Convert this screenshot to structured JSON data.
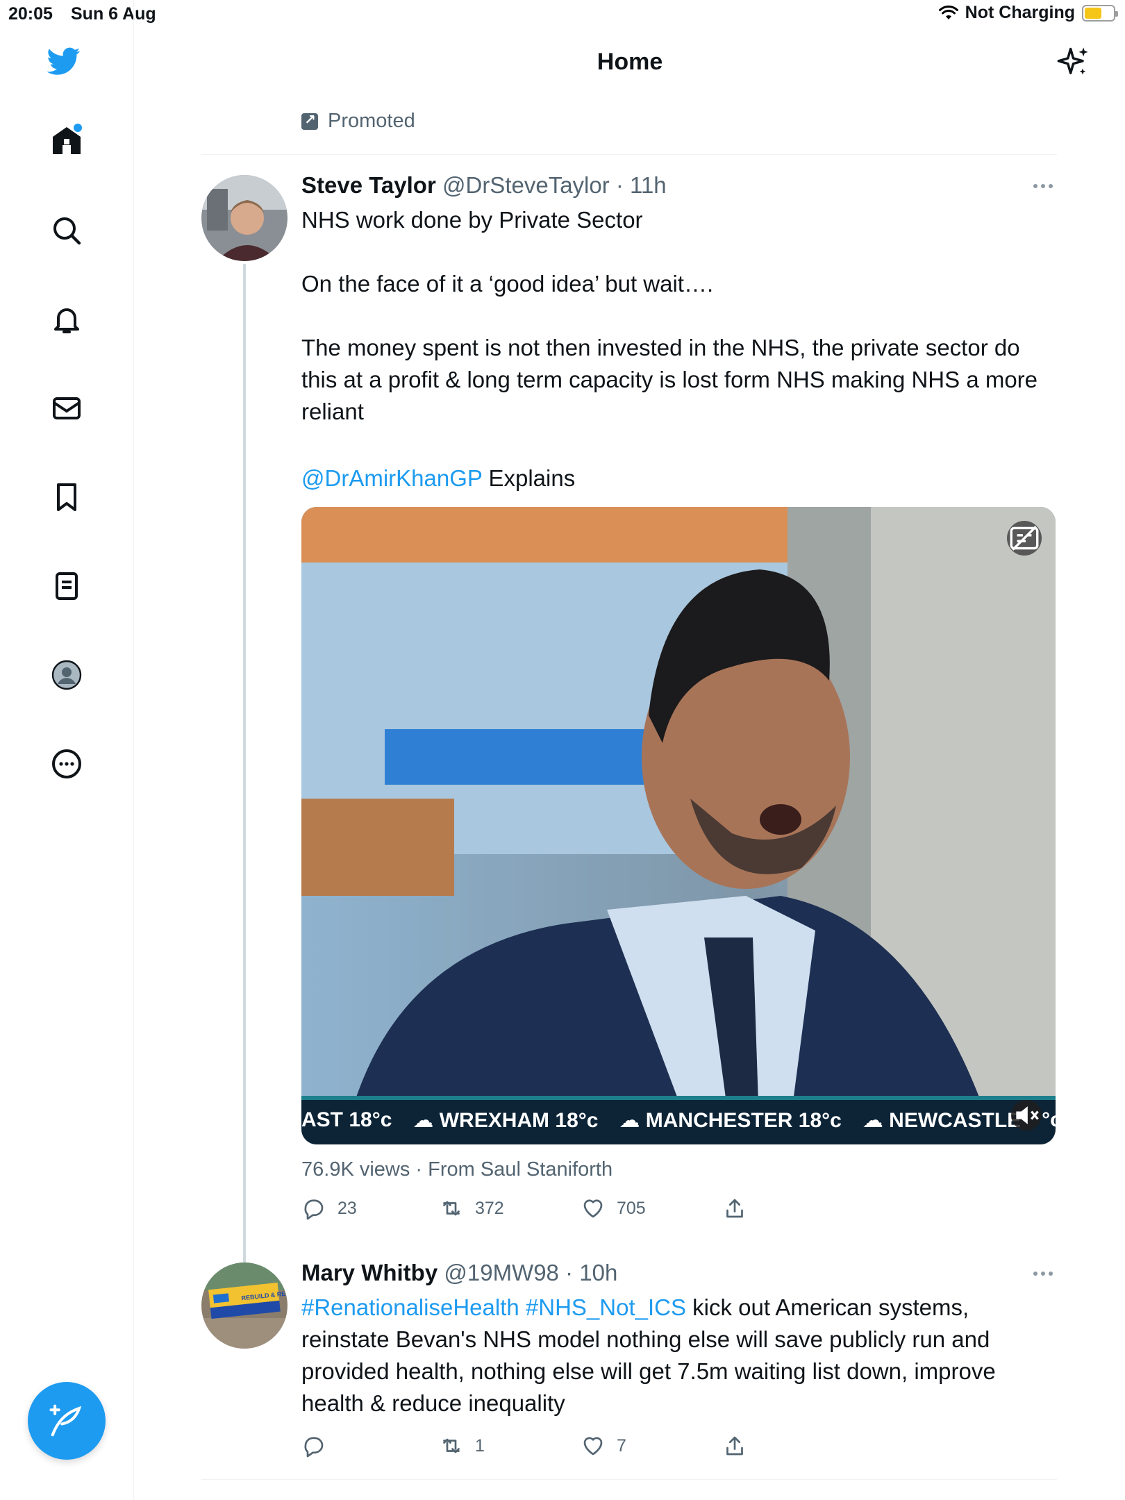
{
  "status_bar": {
    "time": "20:05",
    "date": "Sun 6 Aug",
    "charging": "Not Charging"
  },
  "header": {
    "title": "Home"
  },
  "promoted": {
    "label": "Promoted"
  },
  "tweets": [
    {
      "name": "Steve Taylor",
      "handle": "@DrSteveTaylor",
      "time": "· 11h",
      "line1": "NHS work done by Private Sector",
      "line2": "On the face of it a ‘good idea’ but wait….",
      "line3": "The money spent is not then invested in the NHS, the private sector do this at a profit & long term capacity is lost form NHS making NHS a more reliant",
      "mention": "@DrAmirKhanGP",
      "mention_suffix": " Explains",
      "ticker": [
        "AST  18°c",
        "☁ WREXHAM  18°c",
        "☁ MANCHESTER  18°c",
        "☁ NEWCASTLE",
        "°c"
      ],
      "views": "76.9K views · From Saul Staniforth",
      "replies": "23",
      "retweets": "372",
      "likes": "705"
    },
    {
      "name": "Mary Whitby",
      "handle": "@19MW98",
      "time": "· 10h",
      "hashtag1": "#RenationaliseHealth",
      "hashtag2": "#NHS_Not_ICS",
      "text": " kick out American systems, reinstate Bevan's NHS model nothing else will save publicly run and provided health, nothing else will get 7.5m waiting list down, improve health & reduce inequality",
      "avatar_text": "REBUILD & RESTORE THE NHS",
      "replies": "",
      "retweets": "1",
      "likes": "7"
    }
  ],
  "colors": {
    "accent": "#1d9bf0",
    "secondary_text": "#536471",
    "divider": "#eff3f4"
  },
  "icons": {
    "sidebar": [
      "twitter-logo-icon",
      "home-icon",
      "search-icon",
      "bell-icon",
      "mail-icon",
      "bookmark-icon",
      "lists-icon",
      "profile-icon",
      "more-circle-icon"
    ],
    "compose": "compose-tweet-icon"
  }
}
